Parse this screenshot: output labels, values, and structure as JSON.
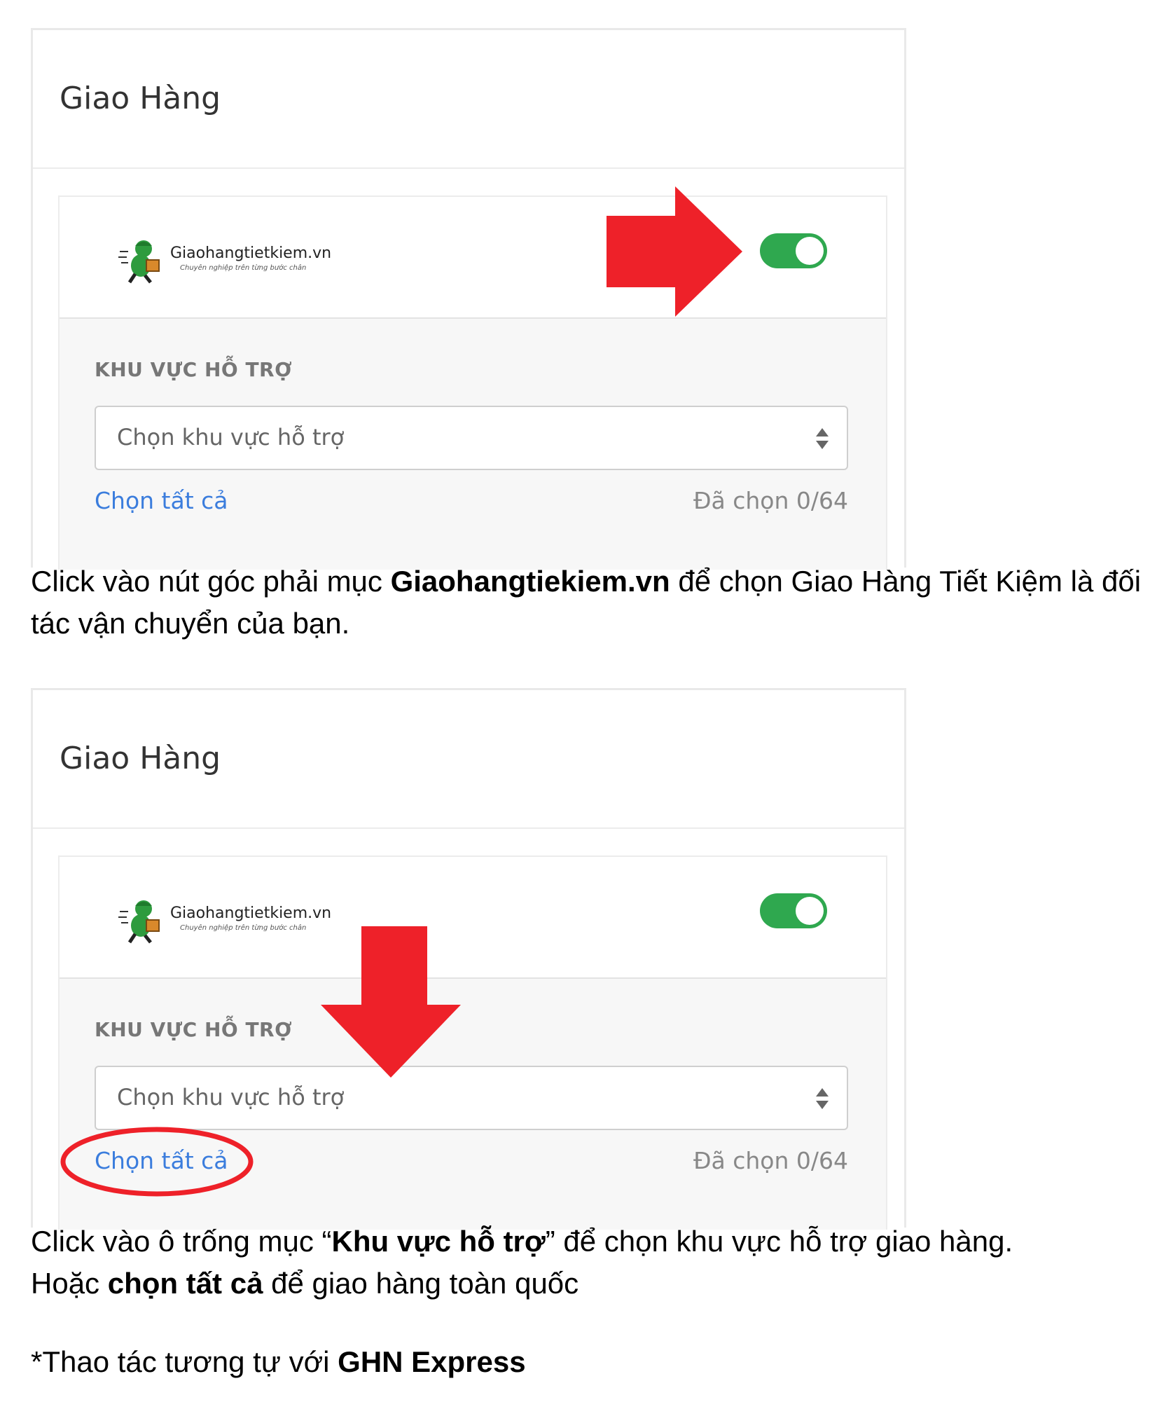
{
  "section1": {
    "card_title": "Giao Hàng",
    "provider_name": "Giaohangtietkiem.vn",
    "provider_tagline": "Chuyên nghiệp trên từng bước chân",
    "toggle_on": true,
    "region_label": "KHU VỰC HỖ TRỢ",
    "region_placeholder": "Chọn khu vực hỗ trợ",
    "select_all": "Chọn tất cả",
    "selected_count": "Đã chọn 0/64",
    "caption": {
      "part1": "Click vào nút góc phải mục ",
      "bold1": "Giaohangtiekiem.vn",
      "part2": " để chọn Giao Hàng Tiết Kiệm là đối tác vận chuyển của bạn."
    }
  },
  "section2": {
    "card_title": "Giao Hàng",
    "provider_name": "Giaohangtietkiem.vn",
    "provider_tagline": "Chuyên nghiệp trên từng bước chân",
    "toggle_on": true,
    "region_label": "KHU VỰC HỖ TRỢ",
    "region_placeholder": "Chọn khu vực hỗ trợ",
    "select_all": "Chọn tất cả",
    "selected_count": "Đã chọn 0/64",
    "caption": {
      "part1": "Click vào ô trống mục “",
      "bold1": "Khu vực hỗ trợ",
      "part2": "” để chọn khu vực hỗ trợ giao hàng.",
      "part3": "Hoặc ",
      "bold2": "chọn tất cả",
      "part4": " để giao hàng toàn quốc"
    }
  },
  "footnote": {
    "part1": "*Thao tác tương tự với ",
    "bold1": "GHN Express"
  },
  "colors": {
    "toggle": "#2fa84f",
    "link": "#3b7ddd",
    "annotation_red": "#ee2129"
  },
  "icons": [
    "delivery-man-icon",
    "sort-arrows-icon",
    "arrow-right-icon",
    "arrow-down-icon"
  ]
}
